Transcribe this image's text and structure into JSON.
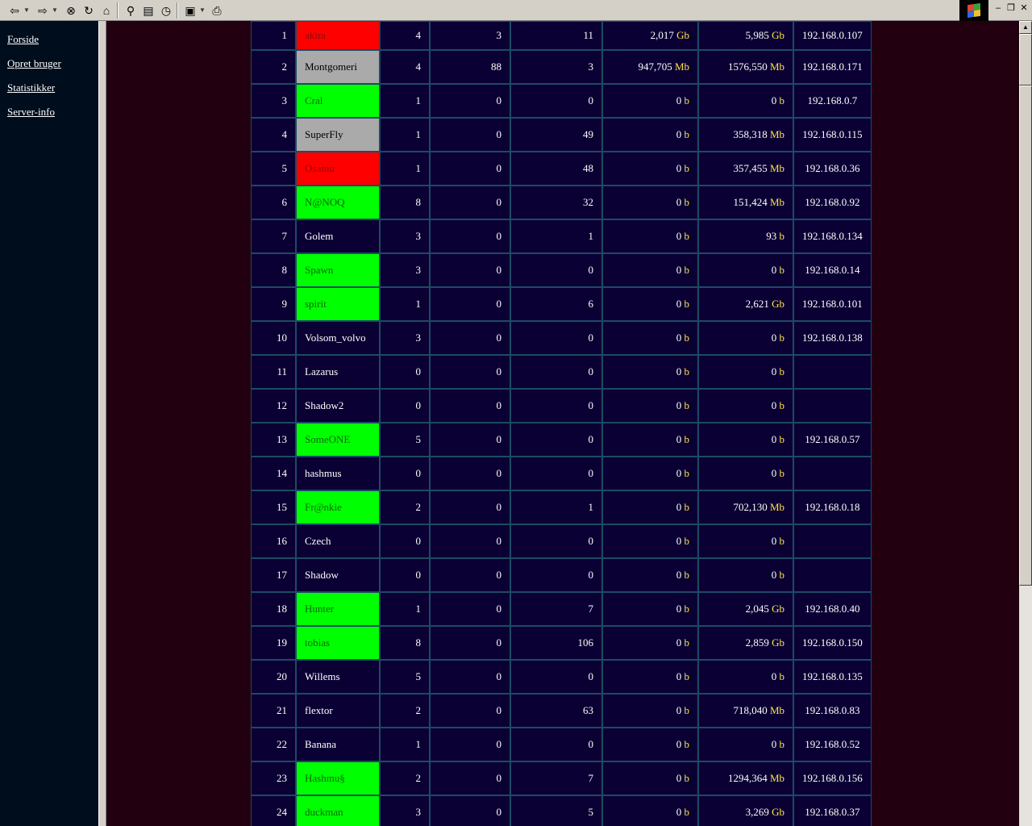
{
  "toolbar": {
    "icons": [
      "back-arrow-icon",
      "forward-arrow-icon",
      "stop-icon",
      "refresh-icon",
      "home-icon",
      "search-icon",
      "favorites-icon",
      "history-icon",
      "edit-icon",
      "print-icon"
    ]
  },
  "nav": {
    "links": [
      {
        "label": "Forside"
      },
      {
        "label": "Opret bruger"
      },
      {
        "label": "Statistikker"
      },
      {
        "label": "Server-info"
      }
    ]
  },
  "colors": {
    "red": "#ff0000",
    "green": "#00ff00",
    "gray": "#aaaaaa",
    "cell_bg": "#0a0033",
    "unit": "#ffe24a"
  },
  "users": [
    {
      "num": "1",
      "name": "akira",
      "status": "red",
      "a": "4",
      "b": "3",
      "c": "11",
      "d_val": "2,017",
      "d_unit": "Gb",
      "e_val": "5,985",
      "e_unit": "Gb",
      "ip": "192.168.0.107"
    },
    {
      "num": "2",
      "name": "Montgomeri",
      "status": "gray",
      "a": "4",
      "b": "88",
      "c": "3",
      "d_val": "947,705",
      "d_unit": "Mb",
      "e_val": "1576,550",
      "e_unit": "Mb",
      "ip": "192.168.0.171"
    },
    {
      "num": "3",
      "name": "Cral",
      "status": "green",
      "a": "1",
      "b": "0",
      "c": "0",
      "d_val": "0",
      "d_unit": "b",
      "e_val": "0",
      "e_unit": "b",
      "ip": "192.168.0.7"
    },
    {
      "num": "4",
      "name": "SuperFly",
      "status": "gray",
      "a": "1",
      "b": "0",
      "c": "49",
      "d_val": "0",
      "d_unit": "b",
      "e_val": "358,318",
      "e_unit": "Mb",
      "ip": "192.168.0.115"
    },
    {
      "num": "5",
      "name": "Osamu",
      "status": "red",
      "a": "1",
      "b": "0",
      "c": "48",
      "d_val": "0",
      "d_unit": "b",
      "e_val": "357,455",
      "e_unit": "Mb",
      "ip": "192.168.0.36"
    },
    {
      "num": "6",
      "name": "N@NOQ",
      "status": "green",
      "a": "8",
      "b": "0",
      "c": "32",
      "d_val": "0",
      "d_unit": "b",
      "e_val": "151,424",
      "e_unit": "Mb",
      "ip": "192.168.0.92"
    },
    {
      "num": "7",
      "name": "Golem",
      "status": "none",
      "a": "3",
      "b": "0",
      "c": "1",
      "d_val": "0",
      "d_unit": "b",
      "e_val": "93",
      "e_unit": "b",
      "ip": "192.168.0.134"
    },
    {
      "num": "8",
      "name": "Spawn",
      "status": "green",
      "a": "3",
      "b": "0",
      "c": "0",
      "d_val": "0",
      "d_unit": "b",
      "e_val": "0",
      "e_unit": "b",
      "ip": "192.168.0.14"
    },
    {
      "num": "9",
      "name": "spirit",
      "status": "green",
      "a": "1",
      "b": "0",
      "c": "6",
      "d_val": "0",
      "d_unit": "b",
      "e_val": "2,621",
      "e_unit": "Gb",
      "ip": "192.168.0.101"
    },
    {
      "num": "10",
      "name": "Volsom_volvo",
      "status": "none",
      "a": "3",
      "b": "0",
      "c": "0",
      "d_val": "0",
      "d_unit": "b",
      "e_val": "0",
      "e_unit": "b",
      "ip": "192.168.0.138"
    },
    {
      "num": "11",
      "name": "Lazarus",
      "status": "none",
      "a": "0",
      "b": "0",
      "c": "0",
      "d_val": "0",
      "d_unit": "b",
      "e_val": "0",
      "e_unit": "b",
      "ip": ""
    },
    {
      "num": "12",
      "name": "Shadow2",
      "status": "none",
      "a": "0",
      "b": "0",
      "c": "0",
      "d_val": "0",
      "d_unit": "b",
      "e_val": "0",
      "e_unit": "b",
      "ip": ""
    },
    {
      "num": "13",
      "name": "SomeONE",
      "status": "green",
      "a": "5",
      "b": "0",
      "c": "0",
      "d_val": "0",
      "d_unit": "b",
      "e_val": "0",
      "e_unit": "b",
      "ip": "192.168.0.57"
    },
    {
      "num": "14",
      "name": "hashmus",
      "status": "none",
      "a": "0",
      "b": "0",
      "c": "0",
      "d_val": "0",
      "d_unit": "b",
      "e_val": "0",
      "e_unit": "b",
      "ip": ""
    },
    {
      "num": "15",
      "name": "Fr@nkie",
      "status": "green",
      "a": "2",
      "b": "0",
      "c": "1",
      "d_val": "0",
      "d_unit": "b",
      "e_val": "702,130",
      "e_unit": "Mb",
      "ip": "192.168.0.18"
    },
    {
      "num": "16",
      "name": "Czech",
      "status": "none",
      "a": "0",
      "b": "0",
      "c": "0",
      "d_val": "0",
      "d_unit": "b",
      "e_val": "0",
      "e_unit": "b",
      "ip": ""
    },
    {
      "num": "17",
      "name": "Shadow",
      "status": "none",
      "a": "0",
      "b": "0",
      "c": "0",
      "d_val": "0",
      "d_unit": "b",
      "e_val": "0",
      "e_unit": "b",
      "ip": ""
    },
    {
      "num": "18",
      "name": "Hunter",
      "status": "green",
      "a": "1",
      "b": "0",
      "c": "7",
      "d_val": "0",
      "d_unit": "b",
      "e_val": "2,045",
      "e_unit": "Gb",
      "ip": "192.168.0.40"
    },
    {
      "num": "19",
      "name": "tobias",
      "status": "green",
      "a": "8",
      "b": "0",
      "c": "106",
      "d_val": "0",
      "d_unit": "b",
      "e_val": "2,859",
      "e_unit": "Gb",
      "ip": "192.168.0.150"
    },
    {
      "num": "20",
      "name": "Willems",
      "status": "none",
      "a": "5",
      "b": "0",
      "c": "0",
      "d_val": "0",
      "d_unit": "b",
      "e_val": "0",
      "e_unit": "b",
      "ip": "192.168.0.135"
    },
    {
      "num": "21",
      "name": "flextor",
      "status": "none",
      "a": "2",
      "b": "0",
      "c": "63",
      "d_val": "0",
      "d_unit": "b",
      "e_val": "718,040",
      "e_unit": "Mb",
      "ip": "192.168.0.83"
    },
    {
      "num": "22",
      "name": "Banana",
      "status": "none",
      "a": "1",
      "b": "0",
      "c": "0",
      "d_val": "0",
      "d_unit": "b",
      "e_val": "0",
      "e_unit": "b",
      "ip": "192.168.0.52"
    },
    {
      "num": "23",
      "name": "Hashmu§",
      "status": "green",
      "a": "2",
      "b": "0",
      "c": "7",
      "d_val": "0",
      "d_unit": "b",
      "e_val": "1294,364",
      "e_unit": "Mb",
      "ip": "192.168.0.156"
    },
    {
      "num": "24",
      "name": "duckman",
      "status": "green",
      "a": "3",
      "b": "0",
      "c": "5",
      "d_val": "0",
      "d_unit": "b",
      "e_val": "3,269",
      "e_unit": "Gb",
      "ip": "192.168.0.37"
    }
  ]
}
